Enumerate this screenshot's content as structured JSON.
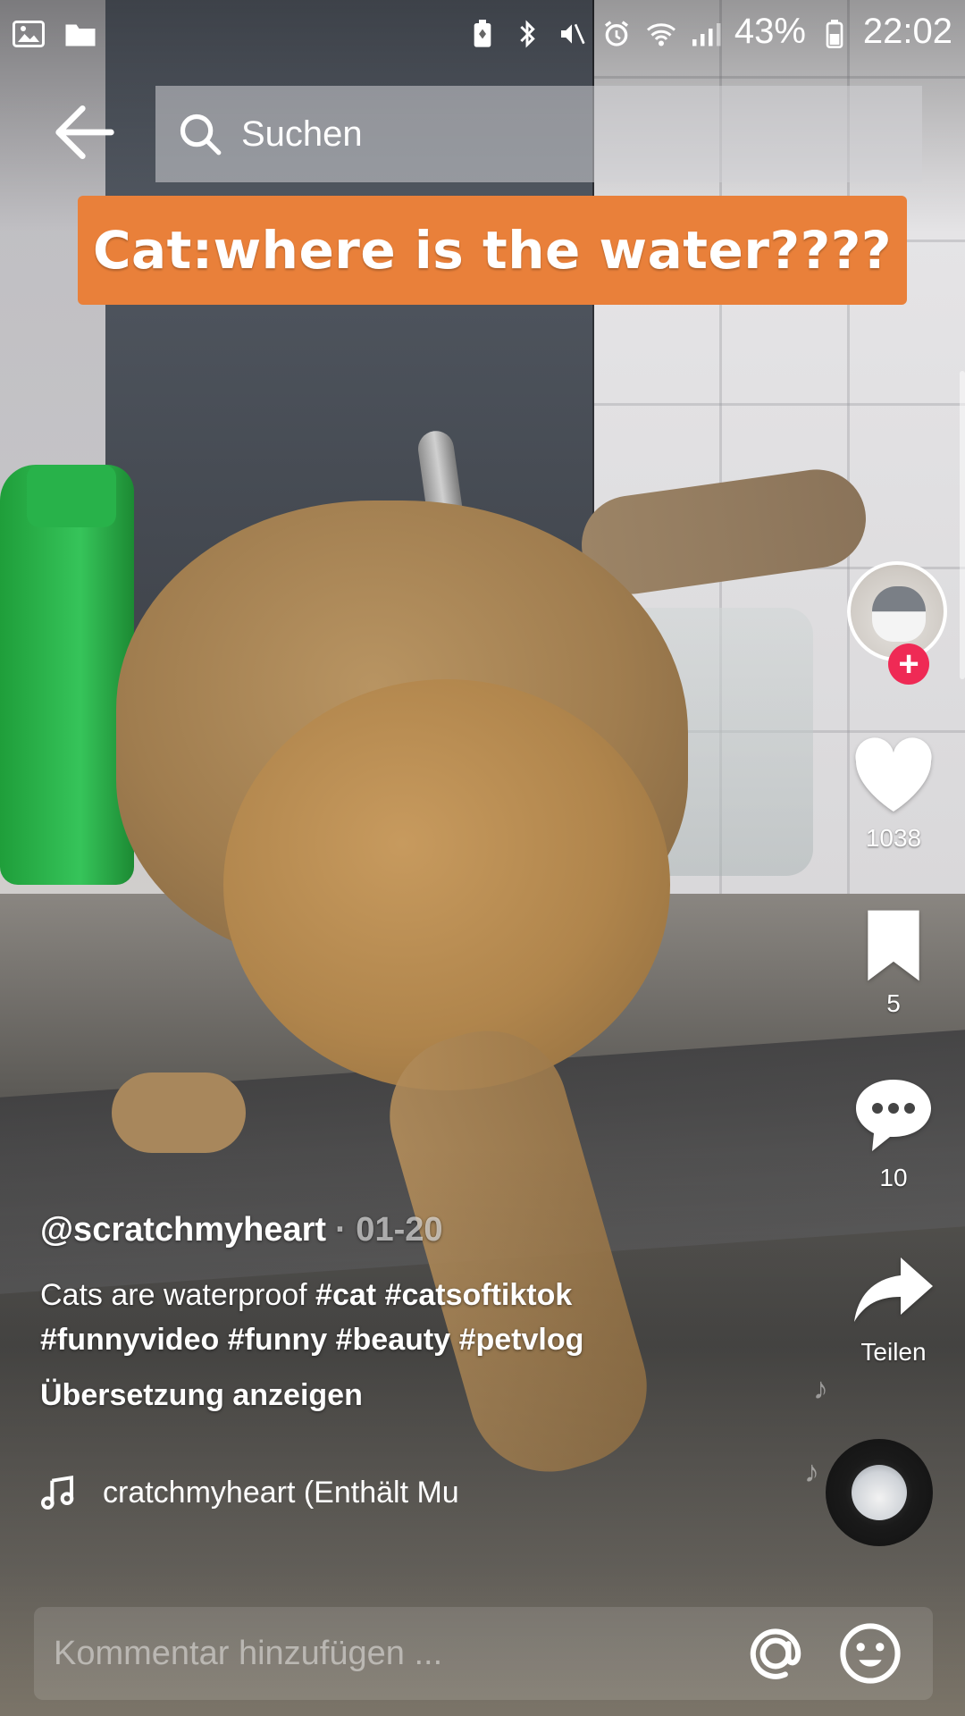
{
  "status_bar": {
    "battery_percent": "43%",
    "time": "22:02"
  },
  "search": {
    "placeholder": "Suchen"
  },
  "video": {
    "caption_overlay": "Cat:where is the water????"
  },
  "actions": {
    "likes": "1038",
    "bookmarks": "5",
    "comments": "10",
    "share_label": "Teilen",
    "follow_symbol": "+"
  },
  "post": {
    "author": "@scratchmyheart",
    "date": "· 01-20",
    "text": "Cats are waterproof",
    "hashtags": [
      "#cat",
      "#catsoftiktok",
      "#funnyvideo",
      "#funny",
      "#beauty",
      "#petvlog"
    ],
    "translate_label": "Übersetzung anzeigen",
    "music": "cratchmyheart (Enthält Mu"
  },
  "comment_bar": {
    "placeholder": "Kommentar hinzufügen ..."
  },
  "colors": {
    "caption_bg": "#e9803a",
    "follow_badge": "#ef2a55"
  }
}
